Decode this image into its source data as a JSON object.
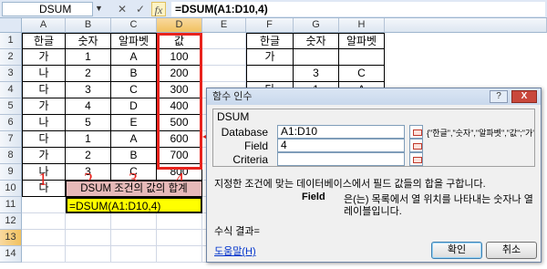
{
  "formula_bar": {
    "name_box": "DSUM",
    "cancel_icon": "✕",
    "enter_icon": "✓",
    "fx_icon": "fx",
    "formula": "=DSUM(A1:D10,4)"
  },
  "columns": [
    "A",
    "B",
    "C",
    "D",
    "E",
    "F",
    "G",
    "H"
  ],
  "rows": [
    "1",
    "2",
    "3",
    "4",
    "5",
    "6",
    "7",
    "8",
    "9",
    "10",
    "11",
    "12",
    "13",
    "14"
  ],
  "table_left": [
    [
      "한글",
      "숫자",
      "알파벳",
      "값"
    ],
    [
      "가",
      "1",
      "A",
      "100"
    ],
    [
      "나",
      "2",
      "B",
      "200"
    ],
    [
      "다",
      "3",
      "C",
      "300"
    ],
    [
      "가",
      "4",
      "D",
      "400"
    ],
    [
      "나",
      "5",
      "E",
      "500"
    ],
    [
      "다",
      "1",
      "A",
      "600"
    ],
    [
      "가",
      "2",
      "B",
      "700"
    ],
    [
      "나",
      "3",
      "C",
      "800"
    ],
    [
      "다",
      "4",
      "D",
      "900"
    ]
  ],
  "table_right": [
    [
      "한글",
      "숫자",
      "알파벳"
    ],
    [
      "가",
      "",
      ""
    ],
    [
      "",
      "3",
      "C"
    ],
    [
      "다",
      "1",
      "A"
    ]
  ],
  "markers": [
    "1",
    "2",
    "3",
    "4"
  ],
  "label_cell": "DSUM 조건의 값의 합계",
  "formula_cell": "=DSUM(A1:D10,4)",
  "dialog": {
    "title": "함수 인수",
    "help_btn": "?",
    "close_btn": "X",
    "function_name": "DSUM",
    "database_label": "Database",
    "database_value": "A1:D10",
    "database_preview": "{\"한글\",\"숫자\",\"알파벳\",\"값\";\"가\",1,\"A\"",
    "field_label": "Field",
    "field_value": "4",
    "criteria_label": "Criteria",
    "criteria_value": "",
    "description": "지정한 조건에 맞는 데이터베이스에서 필드 값들의 합을 구합니다.",
    "field_help_name": "Field",
    "field_help_line1": "은(는) 목록에서 열 위치를 나타내는 숫자나 열",
    "field_help_line2": "레이블입니다.",
    "result_label": "수식 결과=",
    "help_link": "도움말(H)",
    "ok_label": "확인",
    "cancel_label": "취소"
  },
  "colors": {
    "accent_red": "#e8231d",
    "header_bg": "#dfe8f5",
    "selected_header": "#f1c15f",
    "label_cell_bg": "#e6b9b8",
    "formula_cell_bg": "#ffff00"
  }
}
